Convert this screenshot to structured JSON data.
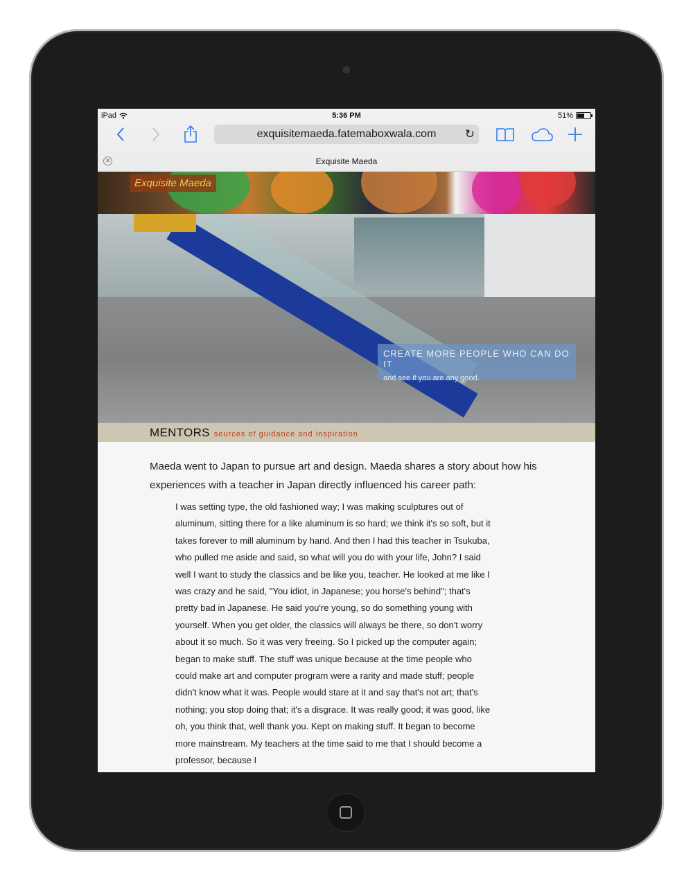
{
  "device": {
    "name": "iPad"
  },
  "status_bar": {
    "carrier": "iPad",
    "time": "5:36 PM",
    "battery": "51%"
  },
  "browser": {
    "url": "exquisitemaeda.fatemaboxwala.com",
    "tab_title": "Exquisite Maeda"
  },
  "site": {
    "logo": "Exquisite Maeda",
    "hero_caption_title": "CREATE MORE PEOPLE WHO CAN DO IT",
    "hero_caption_sub": "and see if you are any good.",
    "section_title": "MENTORS",
    "section_subtitle": "sources of guidance and inspiration",
    "intro": "Maeda went to Japan to pursue art and design. Maeda shares a story about how his experiences with a teacher in Japan directly influenced his career path:",
    "quote": "I was setting type, the old fashioned way; I was making sculptures out of aluminum, sitting there for a like aluminum is so hard; we think it's so soft, but it takes forever to mill aluminum by hand. And then I had this teacher in Tsukuba, who pulled me aside and said, so what will you do with your life, John? I said well I want to study the classics and be like you, teacher. He looked at me like I was crazy and he said, \"You idiot, in Japanese; you horse's behind\"; that's pretty bad in Japanese. He said you're young, so do something young with yourself. When you get older, the classics will always be there, so don't worry about it so much. So it was very freeing. So I picked up the computer again; began to make stuff. The stuff was unique because at the time people who could make art and computer program were a rarity and made stuff; people didn't know what it was. People would stare at it and say that's not art; that's nothing; you stop doing that; it's a disgrace. It was really good; it was good, like oh, you think that, well thank you. Kept on making stuff. It began to become more mainstream. My teachers at the time said to me that I should become a professor, because I"
  },
  "icons": {
    "back": "chevron-left-icon",
    "forward": "chevron-right-icon",
    "share": "share-icon",
    "reload": "reload-icon",
    "bookmarks": "book-icon",
    "icloud": "cloud-icon",
    "new_tab": "plus-icon",
    "close_tab": "close-icon",
    "home": "home-button-icon"
  },
  "colors": {
    "accent": "#2f7cf6",
    "section_bar": "#cdc7b2",
    "section_subtitle": "#c23b1c",
    "logo_text": "#f6c64a"
  }
}
